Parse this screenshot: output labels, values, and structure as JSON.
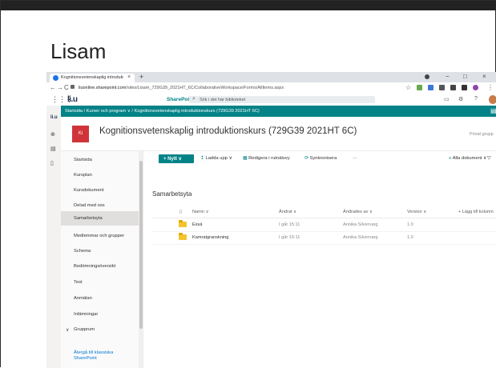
{
  "slide": {
    "title": "Lisam"
  },
  "browser": {
    "tab_title": "Kognitionsvetenskaplig introdukt",
    "tab_close": "×",
    "new_tab": "+",
    "url_host": "liuonline.sharepoint.com",
    "url_path": "/sites/Lisam_729G39_2021HT_6C/CollaborativeWorkspace/Forms/AllItems.aspx",
    "win_min": "−",
    "win_max": "□",
    "win_close": "×",
    "nav_back": "←",
    "nav_forward": "→",
    "nav_reload": "C",
    "star": "☆",
    "menu_dots": "⋮"
  },
  "suite": {
    "waffle": "⋮⋮⋮",
    "logo": "li.u",
    "app_name": "SharePoint",
    "search_placeholder": "Sök i det här biblioteket",
    "help": "?"
  },
  "breadcrumb": {
    "text": "Startsida  /  Kurser och program ∨  /  Kognitionsvetenskaplig introduktionskurs (729G39 2021HT 6C)"
  },
  "site": {
    "logo_text": "Ki",
    "title": "Kognitionsvetenskaplig introduktionskurs (729G39 2021HT 6C)",
    "privacy": "Privat grupp"
  },
  "nav": {
    "items": [
      "Startsida",
      "Kursplan",
      "Kursdokument",
      "Delad med oss",
      "Samarbetsyta",
      "Medlemmar och grupper",
      "Schema",
      "Bedömningsöversikt",
      "Test",
      "Anmälan",
      "Inlämningar",
      "Grupprum"
    ],
    "selected_index": 4,
    "return_link": "Återgå till klassiska SharePoint"
  },
  "commands": {
    "new": "+ Nytt ∨",
    "upload": "Ladda upp ∨",
    "edit_grid": "Redigera i rutnätsvy",
    "sync": "Synkronisera",
    "more": "···",
    "view": "Alla dokument ∨"
  },
  "list": {
    "title": "Samarbetsyta",
    "columns": {
      "name": "Namn ∨",
      "modified": "Ändrat ∨",
      "modified_by": "Ändrades av ∨",
      "version": "Version ∨",
      "add_column": "+ Lägg till kolumn"
    },
    "rows": [
      {
        "name": "Essä",
        "modified": "I går 15:11",
        "modified_by": "Annika Silvervarg",
        "version": "1.0"
      },
      {
        "name": "Kamratgranskning",
        "modified": "I går 15:11",
        "modified_by": "Annika Silvervarg",
        "version": "1.0"
      }
    ]
  },
  "colors": {
    "teal": "#038387",
    "site_logo": "#d13438",
    "folder": "#f4c430"
  }
}
